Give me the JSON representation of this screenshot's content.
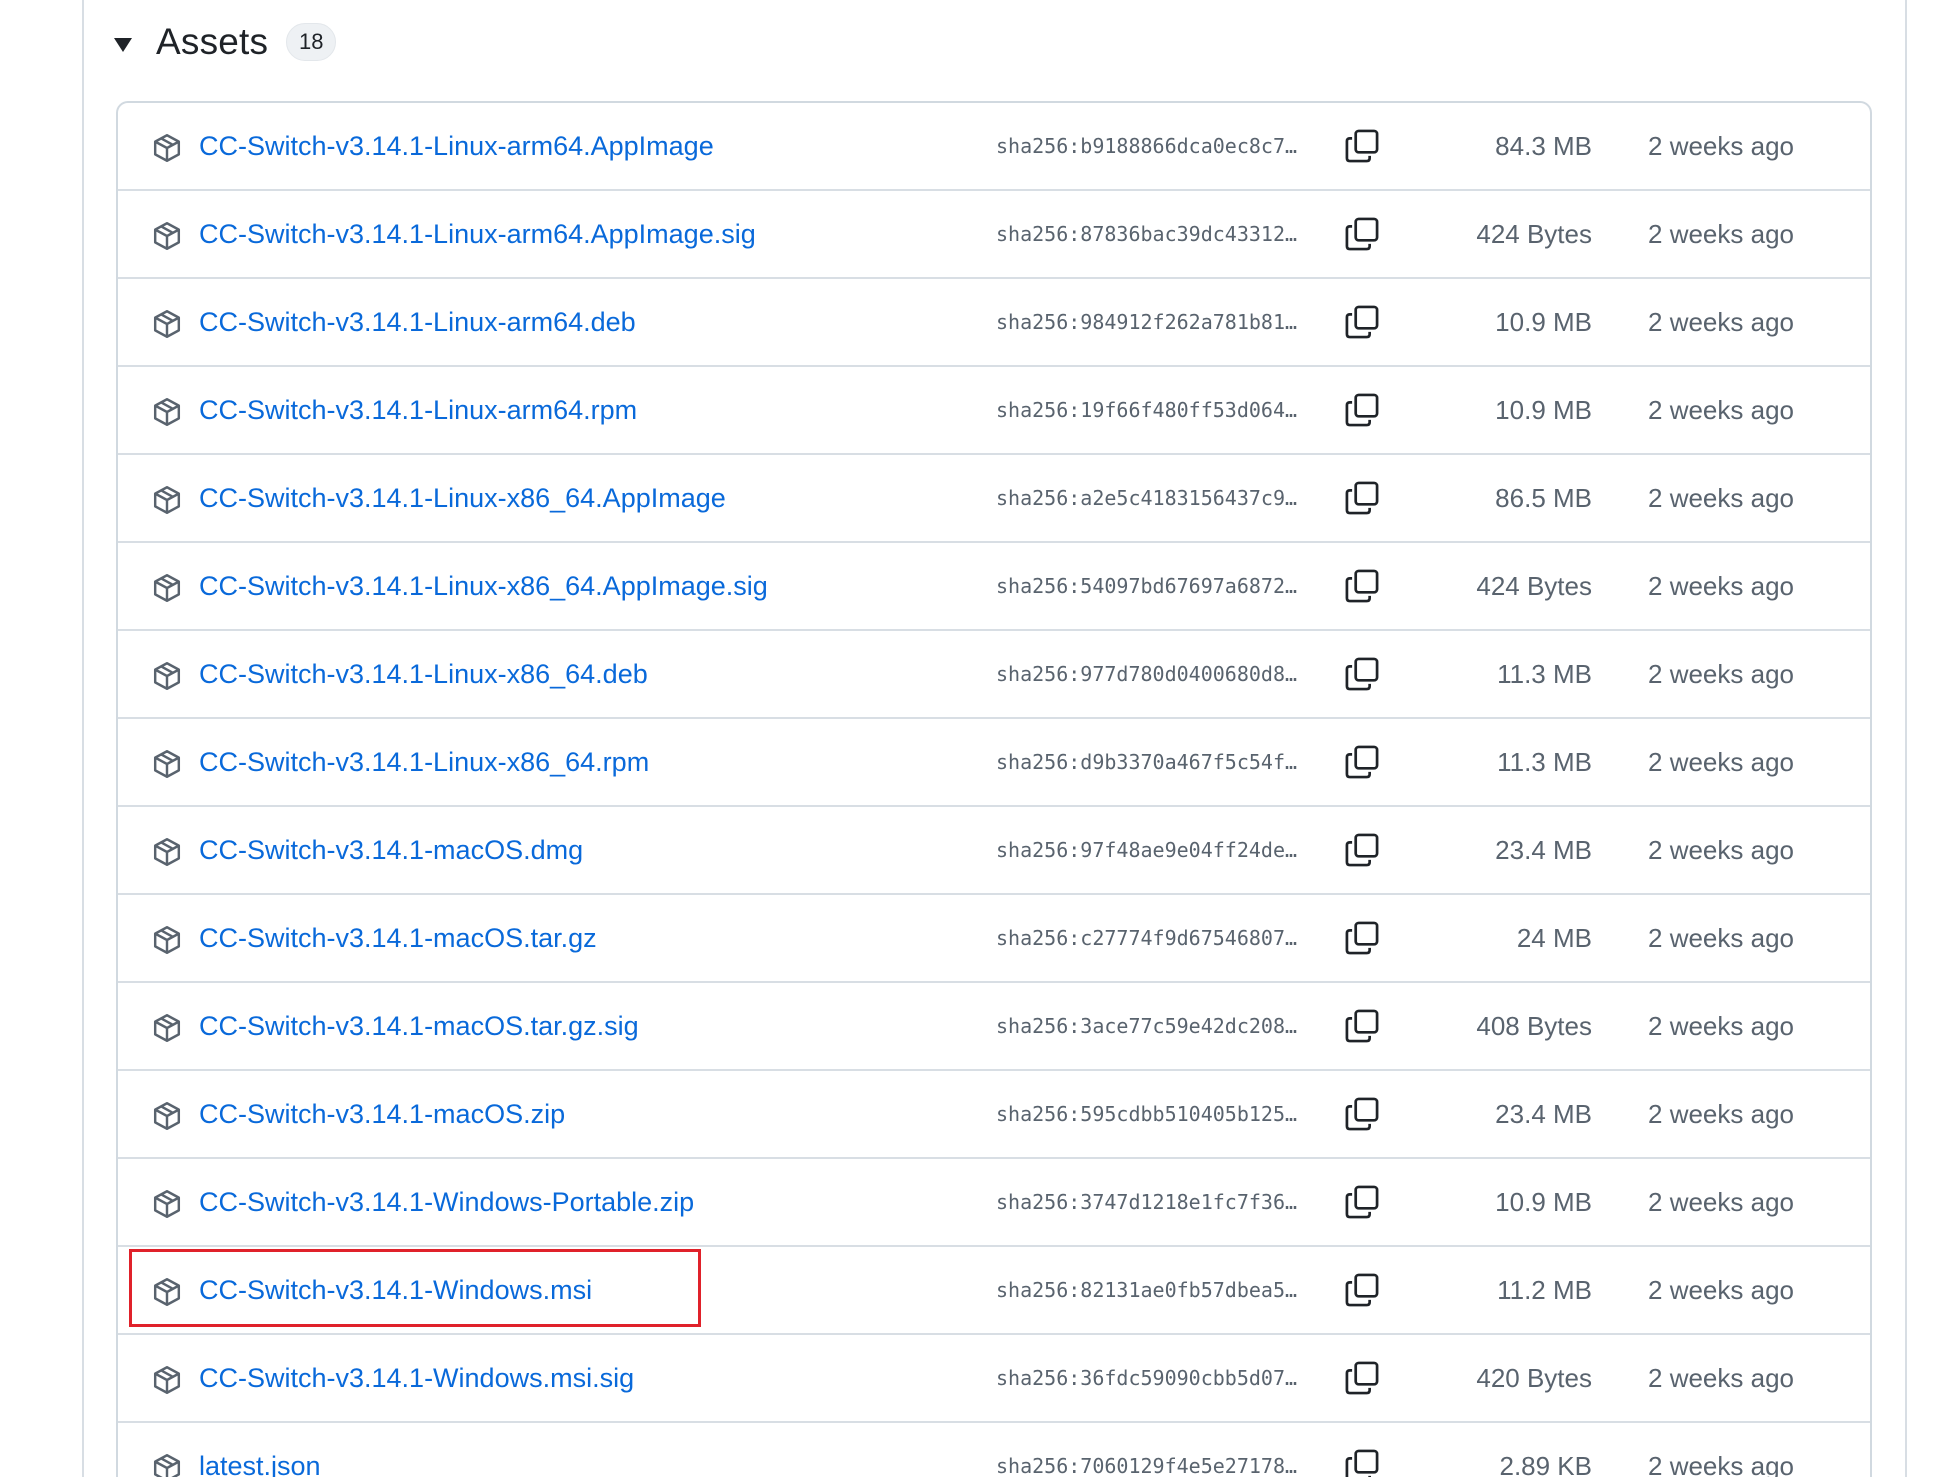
{
  "section": {
    "title": "Assets",
    "count": "18"
  },
  "assets": [
    {
      "name": "CC-Switch-v3.14.1-Linux-arm64.AppImage",
      "sha": "sha256:b9188866dca0ec8c7…",
      "size": "84.3 MB",
      "time": "2 weeks ago"
    },
    {
      "name": "CC-Switch-v3.14.1-Linux-arm64.AppImage.sig",
      "sha": "sha256:87836bac39dc43312…",
      "size": "424 Bytes",
      "time": "2 weeks ago"
    },
    {
      "name": "CC-Switch-v3.14.1-Linux-arm64.deb",
      "sha": "sha256:984912f262a781b81…",
      "size": "10.9 MB",
      "time": "2 weeks ago"
    },
    {
      "name": "CC-Switch-v3.14.1-Linux-arm64.rpm",
      "sha": "sha256:19f66f480ff53d064…",
      "size": "10.9 MB",
      "time": "2 weeks ago"
    },
    {
      "name": "CC-Switch-v3.14.1-Linux-x86_64.AppImage",
      "sha": "sha256:a2e5c4183156437c9…",
      "size": "86.5 MB",
      "time": "2 weeks ago"
    },
    {
      "name": "CC-Switch-v3.14.1-Linux-x86_64.AppImage.sig",
      "sha": "sha256:54097bd67697a6872…",
      "size": "424 Bytes",
      "time": "2 weeks ago"
    },
    {
      "name": "CC-Switch-v3.14.1-Linux-x86_64.deb",
      "sha": "sha256:977d780d0400680d8…",
      "size": "11.3 MB",
      "time": "2 weeks ago"
    },
    {
      "name": "CC-Switch-v3.14.1-Linux-x86_64.rpm",
      "sha": "sha256:d9b3370a467f5c54f…",
      "size": "11.3 MB",
      "time": "2 weeks ago"
    },
    {
      "name": "CC-Switch-v3.14.1-macOS.dmg",
      "sha": "sha256:97f48ae9e04ff24de…",
      "size": "23.4 MB",
      "time": "2 weeks ago"
    },
    {
      "name": "CC-Switch-v3.14.1-macOS.tar.gz",
      "sha": "sha256:c27774f9d67546807…",
      "size": "24 MB",
      "time": "2 weeks ago"
    },
    {
      "name": "CC-Switch-v3.14.1-macOS.tar.gz.sig",
      "sha": "sha256:3ace77c59e42dc208…",
      "size": "408 Bytes",
      "time": "2 weeks ago"
    },
    {
      "name": "CC-Switch-v3.14.1-macOS.zip",
      "sha": "sha256:595cdbb510405b125…",
      "size": "23.4 MB",
      "time": "2 weeks ago"
    },
    {
      "name": "CC-Switch-v3.14.1-Windows-Portable.zip",
      "sha": "sha256:3747d1218e1fc7f36…",
      "size": "10.9 MB",
      "time": "2 weeks ago"
    },
    {
      "name": "CC-Switch-v3.14.1-Windows.msi",
      "sha": "sha256:82131ae0fb57dbea5…",
      "size": "11.2 MB",
      "time": "2 weeks ago"
    },
    {
      "name": "CC-Switch-v3.14.1-Windows.msi.sig",
      "sha": "sha256:36fdc59090cbb5d07…",
      "size": "420 Bytes",
      "time": "2 weeks ago"
    },
    {
      "name": "latest.json",
      "sha": "sha256:7060129f4e5e27178…",
      "size": "2.89 KB",
      "time": "2 weeks ago"
    }
  ],
  "highlighted_asset": "CC-Switch-v3.14.1-Windows.msi",
  "icons": {
    "caret": "triangle-down-icon",
    "asset": "package-icon",
    "copy": "copy-icon"
  },
  "colors": {
    "link": "#0969da",
    "muted": "#59636e",
    "border": "#d1d9e0",
    "highlight": "#e0212a"
  }
}
